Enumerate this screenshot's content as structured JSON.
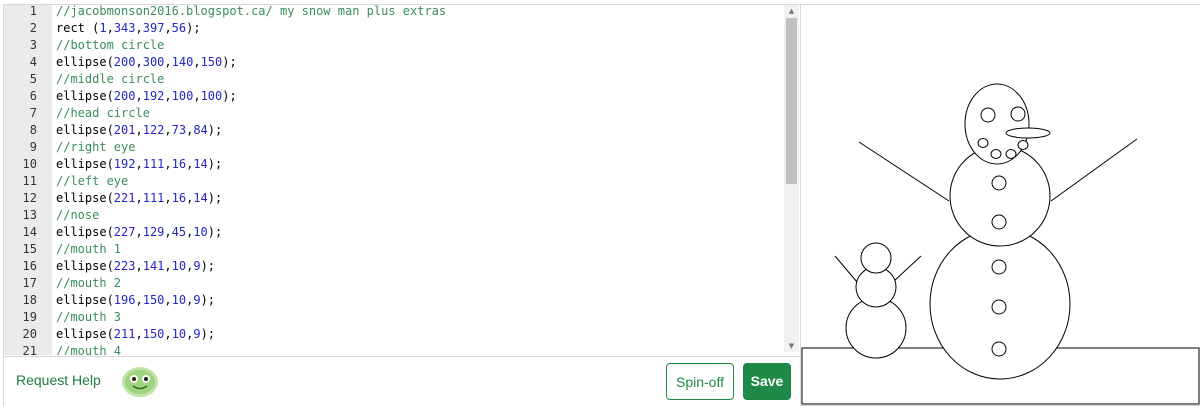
{
  "editor": {
    "lines": [
      {
        "n": "1",
        "parts": [
          {
            "t": "//jacobmonson2016.blogspot.ca/ my snow man plus extras",
            "c": "cmt"
          }
        ]
      },
      {
        "n": "2",
        "parts": [
          {
            "t": "rect (",
            "c": ""
          },
          {
            "t": "1",
            "c": "num"
          },
          {
            "t": ",",
            "c": ""
          },
          {
            "t": "343",
            "c": "num"
          },
          {
            "t": ",",
            "c": ""
          },
          {
            "t": "397",
            "c": "num"
          },
          {
            "t": ",",
            "c": ""
          },
          {
            "t": "56",
            "c": "num"
          },
          {
            "t": ");",
            "c": ""
          }
        ]
      },
      {
        "n": "3",
        "parts": [
          {
            "t": "//bottom circle",
            "c": "cmt"
          }
        ]
      },
      {
        "n": "4",
        "parts": [
          {
            "t": "ellipse(",
            "c": ""
          },
          {
            "t": "200",
            "c": "num"
          },
          {
            "t": ",",
            "c": ""
          },
          {
            "t": "300",
            "c": "num"
          },
          {
            "t": ",",
            "c": ""
          },
          {
            "t": "140",
            "c": "num"
          },
          {
            "t": ",",
            "c": ""
          },
          {
            "t": "150",
            "c": "num"
          },
          {
            "t": ");",
            "c": ""
          }
        ]
      },
      {
        "n": "5",
        "parts": [
          {
            "t": "//middle circle",
            "c": "cmt"
          }
        ]
      },
      {
        "n": "6",
        "parts": [
          {
            "t": "ellipse(",
            "c": ""
          },
          {
            "t": "200",
            "c": "num"
          },
          {
            "t": ",",
            "c": ""
          },
          {
            "t": "192",
            "c": "num"
          },
          {
            "t": ",",
            "c": ""
          },
          {
            "t": "100",
            "c": "num"
          },
          {
            "t": ",",
            "c": ""
          },
          {
            "t": "100",
            "c": "num"
          },
          {
            "t": ");",
            "c": ""
          }
        ]
      },
      {
        "n": "7",
        "parts": [
          {
            "t": "//head circle",
            "c": "cmt"
          }
        ]
      },
      {
        "n": "8",
        "parts": [
          {
            "t": "ellipse(",
            "c": ""
          },
          {
            "t": "201",
            "c": "num"
          },
          {
            "t": ",",
            "c": ""
          },
          {
            "t": "122",
            "c": "num"
          },
          {
            "t": ",",
            "c": ""
          },
          {
            "t": "73",
            "c": "num"
          },
          {
            "t": ",",
            "c": ""
          },
          {
            "t": "84",
            "c": "num"
          },
          {
            "t": ");",
            "c": ""
          }
        ]
      },
      {
        "n": "9",
        "parts": [
          {
            "t": "//right eye",
            "c": "cmt"
          }
        ]
      },
      {
        "n": "10",
        "parts": [
          {
            "t": "ellipse(",
            "c": ""
          },
          {
            "t": "192",
            "c": "num"
          },
          {
            "t": ",",
            "c": ""
          },
          {
            "t": "111",
            "c": "num"
          },
          {
            "t": ",",
            "c": ""
          },
          {
            "t": "16",
            "c": "num"
          },
          {
            "t": ",",
            "c": ""
          },
          {
            "t": "14",
            "c": "num"
          },
          {
            "t": ");",
            "c": ""
          }
        ]
      },
      {
        "n": "11",
        "parts": [
          {
            "t": "//left eye",
            "c": "cmt"
          }
        ]
      },
      {
        "n": "12",
        "parts": [
          {
            "t": "ellipse(",
            "c": ""
          },
          {
            "t": "221",
            "c": "num"
          },
          {
            "t": ",",
            "c": ""
          },
          {
            "t": "111",
            "c": "num"
          },
          {
            "t": ",",
            "c": ""
          },
          {
            "t": "16",
            "c": "num"
          },
          {
            "t": ",",
            "c": ""
          },
          {
            "t": "14",
            "c": "num"
          },
          {
            "t": ");",
            "c": ""
          }
        ]
      },
      {
        "n": "13",
        "parts": [
          {
            "t": "//nose",
            "c": "cmt"
          }
        ]
      },
      {
        "n": "14",
        "parts": [
          {
            "t": "ellipse(",
            "c": ""
          },
          {
            "t": "227",
            "c": "num"
          },
          {
            "t": ",",
            "c": ""
          },
          {
            "t": "129",
            "c": "num"
          },
          {
            "t": ",",
            "c": ""
          },
          {
            "t": "45",
            "c": "num"
          },
          {
            "t": ",",
            "c": ""
          },
          {
            "t": "10",
            "c": "num"
          },
          {
            "t": ");",
            "c": ""
          }
        ]
      },
      {
        "n": "15",
        "parts": [
          {
            "t": "//mouth 1",
            "c": "cmt"
          }
        ]
      },
      {
        "n": "16",
        "parts": [
          {
            "t": "ellipse(",
            "c": ""
          },
          {
            "t": "223",
            "c": "num"
          },
          {
            "t": ",",
            "c": ""
          },
          {
            "t": "141",
            "c": "num"
          },
          {
            "t": ",",
            "c": ""
          },
          {
            "t": "10",
            "c": "num"
          },
          {
            "t": ",",
            "c": ""
          },
          {
            "t": "9",
            "c": "num"
          },
          {
            "t": ");",
            "c": ""
          }
        ]
      },
      {
        "n": "17",
        "parts": [
          {
            "t": "//mouth 2",
            "c": "cmt"
          }
        ]
      },
      {
        "n": "18",
        "parts": [
          {
            "t": "ellipse(",
            "c": ""
          },
          {
            "t": "196",
            "c": "num"
          },
          {
            "t": ",",
            "c": ""
          },
          {
            "t": "150",
            "c": "num"
          },
          {
            "t": ",",
            "c": ""
          },
          {
            "t": "10",
            "c": "num"
          },
          {
            "t": ",",
            "c": ""
          },
          {
            "t": "9",
            "c": "num"
          },
          {
            "t": ");",
            "c": ""
          }
        ]
      },
      {
        "n": "19",
        "parts": [
          {
            "t": "//mouth 3",
            "c": "cmt"
          }
        ]
      },
      {
        "n": "20",
        "parts": [
          {
            "t": "ellipse(",
            "c": ""
          },
          {
            "t": "211",
            "c": "num"
          },
          {
            "t": ",",
            "c": ""
          },
          {
            "t": "150",
            "c": "num"
          },
          {
            "t": ",",
            "c": ""
          },
          {
            "t": "10",
            "c": "num"
          },
          {
            "t": ",",
            "c": ""
          },
          {
            "t": "9",
            "c": "num"
          },
          {
            "t": ");",
            "c": ""
          }
        ]
      },
      {
        "n": "21",
        "parts": [
          {
            "t": "//mouth 4",
            "c": "cmt"
          }
        ]
      }
    ]
  },
  "toolbar": {
    "request_help_label": "Request Help",
    "avatar_icon": "green-avatar-icon",
    "spinoff_label": "Spin-off",
    "save_label": "Save"
  },
  "scrollbar": {
    "up_icon": "▲",
    "down_icon": "▼"
  },
  "colors": {
    "accent": "#1f8a47",
    "comment": "#3a8d5c",
    "number": "#2526c6"
  }
}
